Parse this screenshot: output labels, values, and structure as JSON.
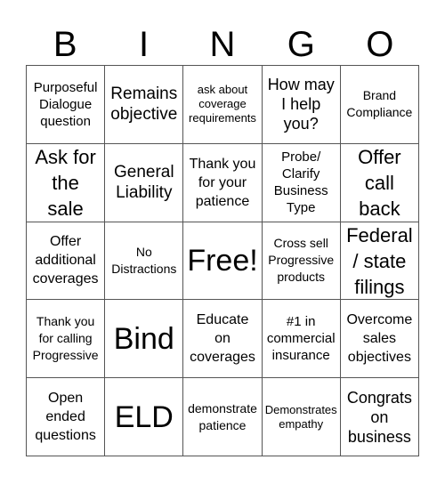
{
  "header": {
    "letters": [
      "B",
      "I",
      "N",
      "G",
      "O"
    ]
  },
  "card": {
    "rows": [
      [
        {
          "text": "Purposeful\nDialogue\nquestion"
        },
        {
          "text": "Remains\nobjective"
        },
        {
          "text": "ask about\ncoverage\nrequirements"
        },
        {
          "text": "How may\nI help\nyou?"
        },
        {
          "text": "Brand\nCompliance"
        }
      ],
      [
        {
          "text": "Ask for\nthe\nsale"
        },
        {
          "text": "General\nLiability"
        },
        {
          "text": "Thank you\nfor your\npatience"
        },
        {
          "text": "Probe/\nClarify\nBusiness\nType"
        },
        {
          "text": "Offer\ncall\nback"
        }
      ],
      [
        {
          "text": "Offer\nadditional\ncoverages"
        },
        {
          "text": "No\nDistractions"
        },
        {
          "text": "Free!"
        },
        {
          "text": "Cross sell\nProgressive\nproducts"
        },
        {
          "text": "Federal\n/ state\nfilings"
        }
      ],
      [
        {
          "text": "Thank you\nfor calling\nProgressive"
        },
        {
          "text": "Bind"
        },
        {
          "text": "Educate\non\ncoverages"
        },
        {
          "text": "#1 in\ncommercial\ninsurance"
        },
        {
          "text": "Overcome\nsales\nobjectives"
        }
      ],
      [
        {
          "text": "Open\nended\nquestions"
        },
        {
          "text": "ELD"
        },
        {
          "text": "demonstrate\npatience"
        },
        {
          "text": "Demonstrates\nempathy"
        },
        {
          "text": "Congrats\non\nbusiness"
        }
      ]
    ]
  }
}
